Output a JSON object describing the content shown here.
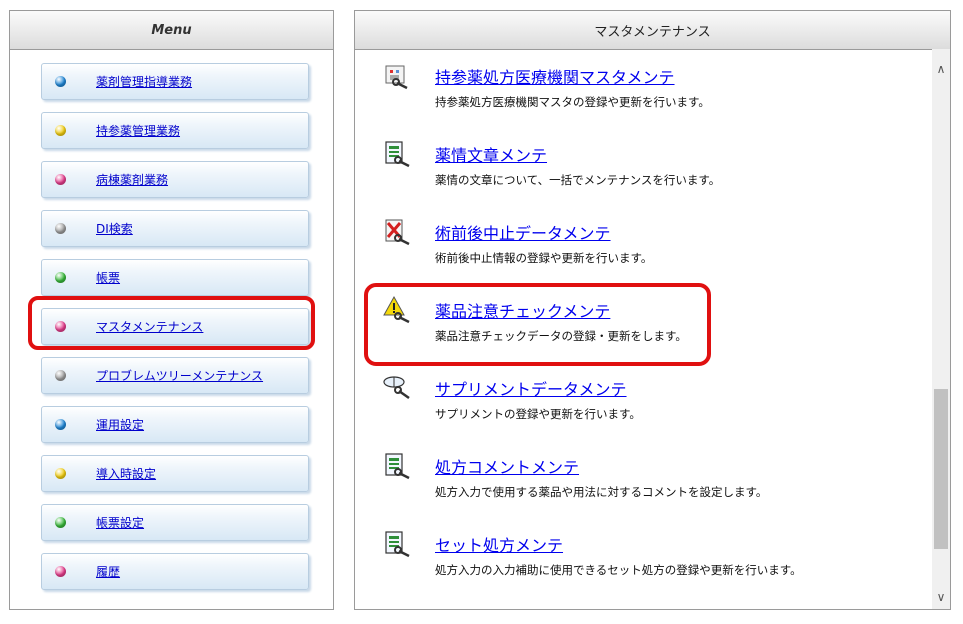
{
  "menu": {
    "header": "Menu",
    "items": [
      {
        "label": "薬剤管理指導業務",
        "color": "#1f86d6"
      },
      {
        "label": "持参薬管理業務",
        "color": "#f0cc10"
      },
      {
        "label": "病棟薬剤業務",
        "color": "#e43d8c"
      },
      {
        "label": "DI検索",
        "color": "#9c9c9c"
      },
      {
        "label": "帳票",
        "color": "#38b83a"
      },
      {
        "label": "マスタメンテナンス",
        "color": "#e43d8c"
      },
      {
        "label": "プロブレムツリーメンテナンス",
        "color": "#9c9c9c"
      },
      {
        "label": "運用設定",
        "color": "#1f86d6"
      },
      {
        "label": "導入時設定",
        "color": "#f0cc10"
      },
      {
        "label": "帳票設定",
        "color": "#38b83a"
      },
      {
        "label": "履歴",
        "color": "#e43d8c"
      }
    ]
  },
  "main": {
    "header": "マスタメンテナンス",
    "entries": [
      {
        "title": "持参薬処方医療機関マスタメンテ",
        "desc": "持参薬処方医療機関マスタの登録や更新を行います。",
        "icon": "hospital-wrench-icon"
      },
      {
        "title": "薬情文章メンテ",
        "desc": "薬情の文章について、一括でメンテナンスを行います。",
        "icon": "document-wrench-icon"
      },
      {
        "title": "術前後中止データメンテ",
        "desc": "術前後中止情報の登録や更新を行います。",
        "icon": "stop-wrench-icon"
      },
      {
        "title": "薬品注意チェックメンテ",
        "desc": "薬品注意チェックデータの登録・更新をします。",
        "icon": "warning-wrench-icon"
      },
      {
        "title": "サプリメントデータメンテ",
        "desc": "サプリメントの登録や更新を行います。",
        "icon": "capsule-wrench-icon"
      },
      {
        "title": "処方コメントメンテ",
        "desc": "処方入力で使用する薬品や用法に対するコメントを設定します。",
        "icon": "document-wrench-icon"
      },
      {
        "title": "セット処方メンテ",
        "desc": "処方入力の入力補助に使用できるセット処方の登録や更新を行います。",
        "icon": "document-wrench-icon"
      }
    ]
  },
  "colors": {
    "highlight": "#e01010",
    "link": "#0000ee"
  }
}
